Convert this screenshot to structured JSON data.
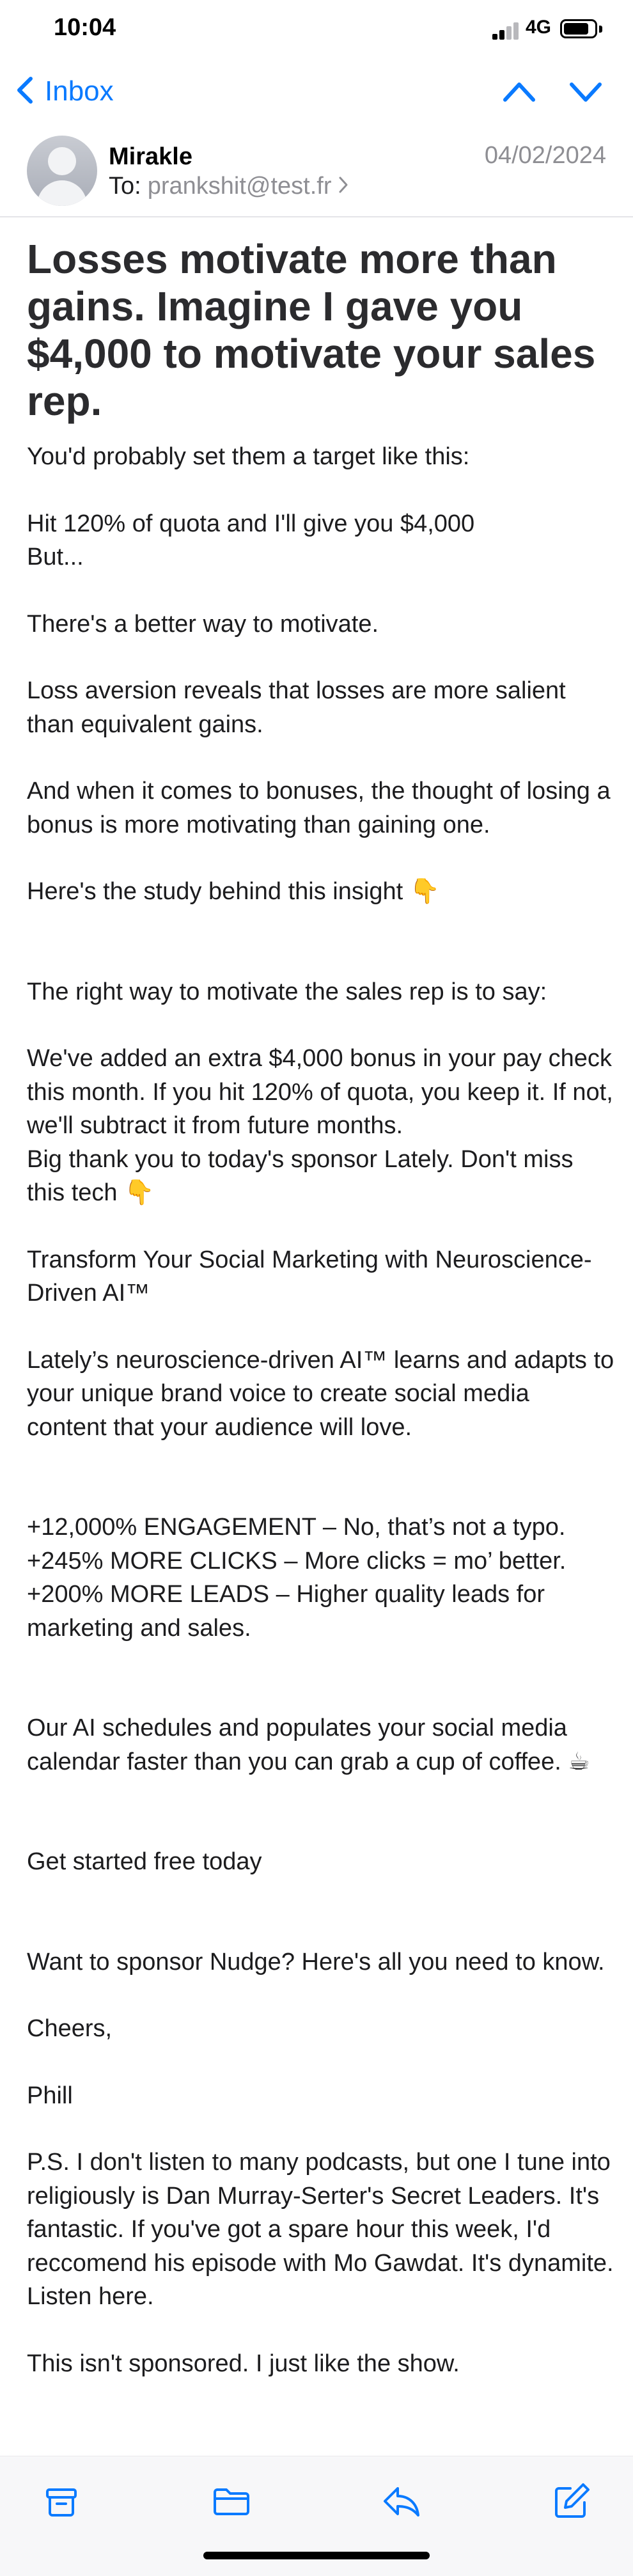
{
  "status_bar": {
    "time": "10:04",
    "network": "4G"
  },
  "nav": {
    "back_label": "Inbox"
  },
  "message": {
    "sender_name": "Mirakle",
    "to_label": "To:",
    "to_address": "prankshit@test.fr",
    "date": "04/02/2024",
    "subject": "Losses motivate more than gains. Imagine I gave you $4,000 to motivate your sales rep.",
    "body": [
      "You'd probably set them a target like this:",
      "Hit 120% of quota and I'll give you $4,000\nBut...",
      "There's a better way to motivate.",
      "Loss aversion reveals that losses are more salient than equivalent gains.",
      "And when it comes to bonuses, the thought of losing a bonus is more motivating than gaining one.",
      "Here's the study behind this insight 👇",
      "The right way to motivate the sales rep is to say:",
      "We've added an extra $4,000 bonus in your pay check this month. If you hit 120% of quota, you keep it. If not, we'll subtract it from future months.\nBig thank you to today's sponsor Lately. Don't miss this tech 👇",
      "Transform Your Social Marketing with Neuroscience-Driven AI™",
      "Lately’s neuroscience-driven AI™ learns and adapts to your unique brand voice to create social media content that your audience will love.",
      "+12,000% ENGAGEMENT – No, that’s not a typo.\n+245% MORE CLICKS – More clicks = mo’ better.\n+200% MORE LEADS – Higher quality leads for marketing and sales.",
      "Our AI schedules and populates your social media calendar faster than you can grab a cup of coffee. ☕",
      "Get started free today",
      "Want to sponsor Nudge? Here's all you need to know.",
      "Cheers,",
      "Phill",
      "P.S. I don't listen to many podcasts, but one I tune into religiously is Dan Murray-Serter's Secret Leaders. It's fantastic. If you've got a spare hour this week, I'd reccomend his episode with Mo Gawdat. It's dynamite. Listen here.",
      "This isn't sponsored. I just like the show."
    ]
  },
  "icons": {
    "back": "chevron-left-icon",
    "prev": "chevron-up-icon",
    "next": "chevron-down-icon",
    "archive": "archive-icon",
    "move": "folder-icon",
    "reply": "reply-icon",
    "compose": "compose-icon"
  },
  "colors": {
    "accent": "#0a7aff",
    "secondary_text": "#8e8e93"
  }
}
